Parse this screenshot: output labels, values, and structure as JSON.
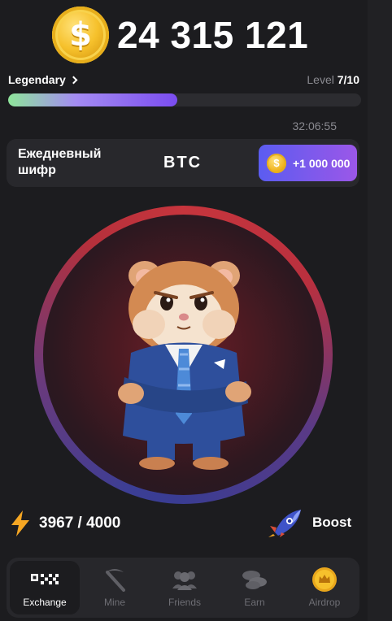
{
  "balance": {
    "value": "24 315 121",
    "coin_icon": "dollar-coin-icon"
  },
  "level": {
    "rank": "Legendary",
    "label": "Level",
    "value": "7/10",
    "progress": 0.48
  },
  "timer": "32:06:55",
  "daily_cipher": {
    "label": "Ежедневный шифр",
    "code": "BTC",
    "reward": "+1 000 000"
  },
  "energy": {
    "value": "3967 / 4000"
  },
  "boost": {
    "label": "Boost"
  },
  "nav": {
    "items": [
      {
        "label": "Exchange",
        "icon": "exchange-logo-icon",
        "active": true
      },
      {
        "label": "Mine",
        "icon": "pickaxe-icon",
        "active": false
      },
      {
        "label": "Friends",
        "icon": "friends-icon",
        "active": false
      },
      {
        "label": "Earn",
        "icon": "coins-icon",
        "active": false
      },
      {
        "label": "Airdrop",
        "icon": "airdrop-coin-icon",
        "active": false
      }
    ]
  },
  "colors": {
    "background": "#1c1c1f",
    "accent_purple": "#7a4cf0",
    "coin_gold": "#f6c12c",
    "energy_orange": "#f5a623"
  }
}
